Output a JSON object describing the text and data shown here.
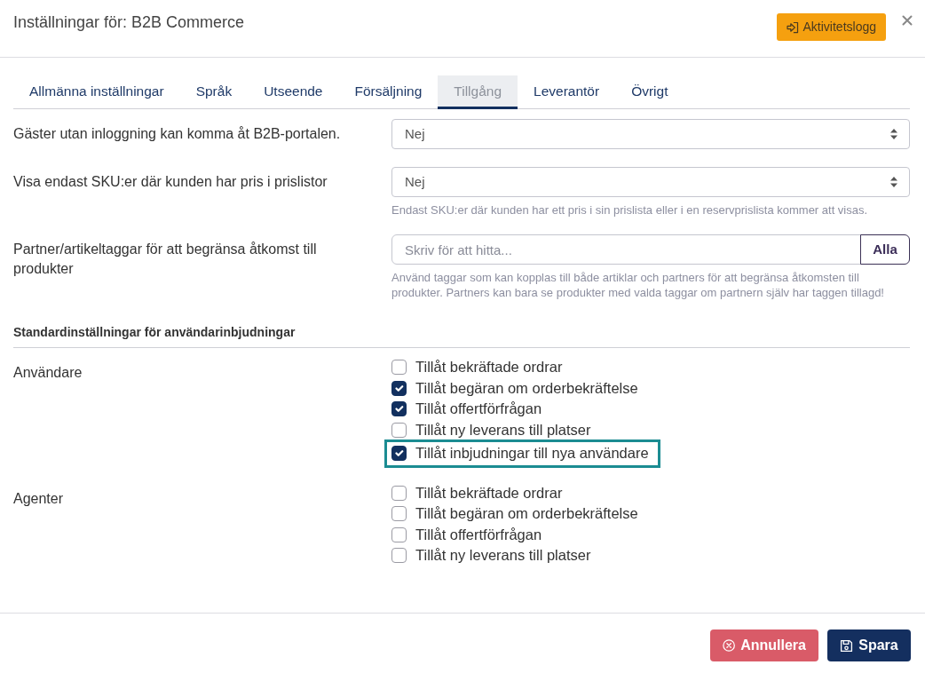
{
  "dialog": {
    "title": "Inställningar för: B2B Commerce",
    "activity_button": "Aktivitetslogg"
  },
  "tabs": [
    {
      "label": "Allmänna inställningar",
      "selected": false
    },
    {
      "label": "Språk",
      "selected": false
    },
    {
      "label": "Utseende",
      "selected": false
    },
    {
      "label": "Försäljning",
      "selected": false
    },
    {
      "label": "Tillgång",
      "selected": true
    },
    {
      "label": "Leverantör",
      "selected": false
    },
    {
      "label": "Övrigt",
      "selected": false
    }
  ],
  "settings": [
    {
      "kind": "select",
      "label": "Gäster utan inloggning kan komma åt B2B-portalen.",
      "value": "Nej"
    },
    {
      "kind": "select",
      "label": "Visa endast SKU:er där kunden har pris i prislistor",
      "value": "Nej",
      "help": "Endast SKU:er där kunden har ett pris i sin prislista eller i en reservprislista kommer att visas."
    },
    {
      "kind": "tags",
      "label": "Partner/artikeltaggar för att begränsa åtkomst till produkter",
      "placeholder": "Skriv för att hitta...",
      "button": "Alla",
      "help": "Använd taggar som kan kopplas till både artiklar och partners för att begränsa åtkomsten till produkter. Partners kan bara se produkter med valda taggar om partnern själv har taggen tillagd!"
    }
  ],
  "invitation_defaults": {
    "heading": "Standardinställningar för användarinbjudningar",
    "groups": [
      {
        "label": "Användare",
        "options": [
          {
            "label": "Tillåt bekräftade ordrar",
            "checked": false,
            "highlighted": false
          },
          {
            "label": "Tillåt begäran om orderbekräftelse",
            "checked": true,
            "highlighted": false
          },
          {
            "label": "Tillåt offertförfrågan",
            "checked": true,
            "highlighted": false
          },
          {
            "label": "Tillåt ny leverans till platser",
            "checked": false,
            "highlighted": false
          },
          {
            "label": "Tillåt inbjudningar till nya användare",
            "checked": true,
            "highlighted": true
          }
        ]
      },
      {
        "label": "Agenter",
        "options": [
          {
            "label": "Tillåt bekräftade ordrar",
            "checked": false,
            "highlighted": false
          },
          {
            "label": "Tillåt begäran om orderbekräftelse",
            "checked": false,
            "highlighted": false
          },
          {
            "label": "Tillåt offertförfrågan",
            "checked": false,
            "highlighted": false
          },
          {
            "label": "Tillåt ny leverans till platser",
            "checked": false,
            "highlighted": false
          }
        ]
      }
    ]
  },
  "footer": {
    "buttons": [
      {
        "kind": "cancel",
        "label": "Annullera"
      },
      {
        "kind": "save",
        "label": "Spara"
      }
    ]
  }
}
